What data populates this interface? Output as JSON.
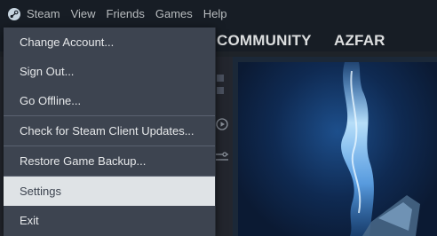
{
  "menubar": {
    "logo_icon": "steam-logo-icon",
    "items": [
      "Steam",
      "View",
      "Friends",
      "Games",
      "Help"
    ]
  },
  "nav": {
    "community": "COMMUNITY",
    "username": "AZFAR"
  },
  "steam_menu": {
    "items": [
      {
        "label": "Change Account..."
      },
      {
        "label": "Sign Out..."
      },
      {
        "label": "Go Offline..."
      },
      {
        "label": "Check for Steam Client Updates..."
      },
      {
        "label": "Restore Game Backup..."
      },
      {
        "label": "Settings",
        "selected": true
      },
      {
        "label": "Exit"
      }
    ]
  },
  "colors": {
    "menu_bg": "#3d4450",
    "menu_hover": "#dfe3e6",
    "topbar": "#171d25"
  }
}
